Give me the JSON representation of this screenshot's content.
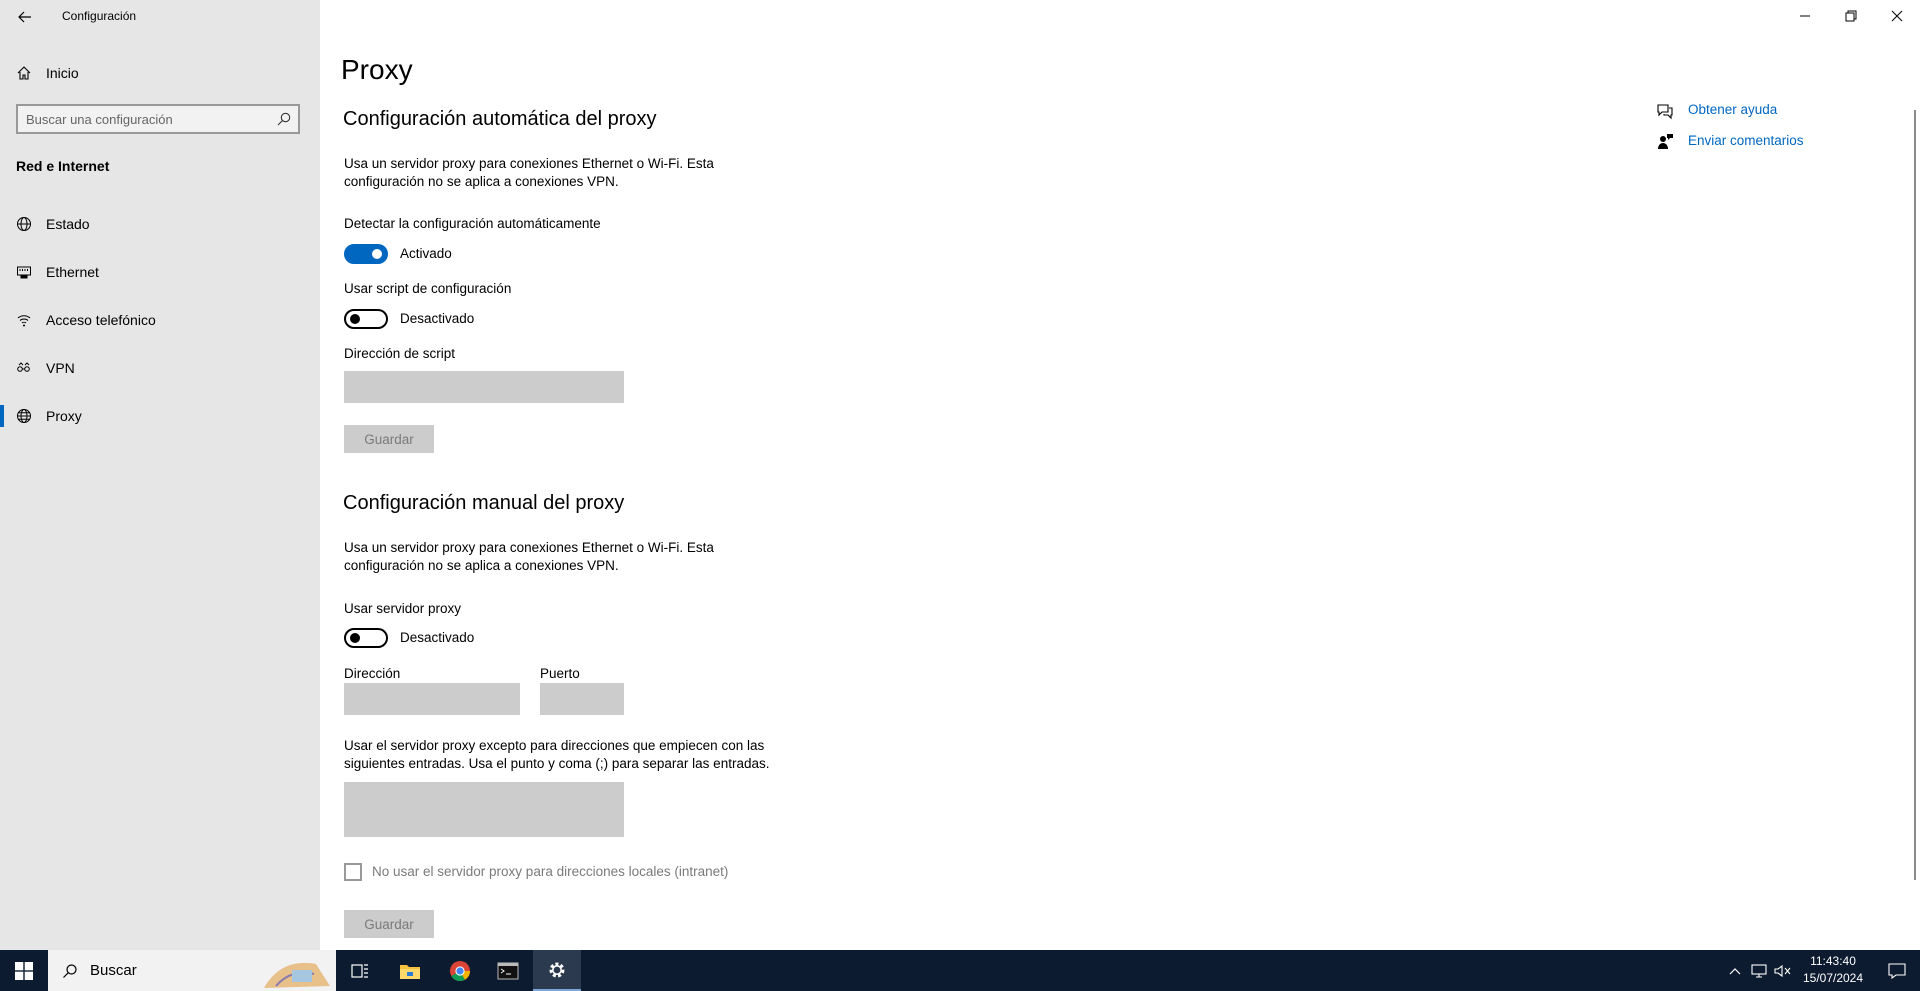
{
  "window": {
    "title": "Configuración",
    "back_icon": "back-arrow-icon",
    "controls": [
      "minimize-icon",
      "restore-icon",
      "close-icon"
    ]
  },
  "sidebar": {
    "home_label": "Inicio",
    "search": {
      "placeholder": "Buscar una configuración",
      "value": ""
    },
    "section_label": "Red e Internet",
    "items": [
      {
        "label": "Estado",
        "icon": "globe-status-icon",
        "active": false
      },
      {
        "label": "Ethernet",
        "icon": "ethernet-icon",
        "active": false
      },
      {
        "label": "Acceso telefónico",
        "icon": "dialup-icon",
        "active": false
      },
      {
        "label": "VPN",
        "icon": "vpn-icon",
        "active": false
      },
      {
        "label": "Proxy",
        "icon": "globe-icon",
        "active": true
      }
    ]
  },
  "main": {
    "page_title": "Proxy",
    "auto": {
      "heading": "Configuración automática del proxy",
      "description": "Usa un servidor proxy para conexiones Ethernet o Wi-Fi. Esta configuración no se aplica a conexiones VPN.",
      "detect_label": "Detectar la configuración automáticamente",
      "detect_state": "Activado",
      "detect_on": true,
      "script_label": "Usar script de configuración",
      "script_state": "Desactivado",
      "script_on": false,
      "address_label": "Dirección de script",
      "address_value": "",
      "save_label": "Guardar"
    },
    "manual": {
      "heading": "Configuración manual del proxy",
      "description": "Usa un servidor proxy para conexiones Ethernet o Wi-Fi. Esta configuración no se aplica a conexiones VPN.",
      "use_proxy_label": "Usar servidor proxy",
      "use_proxy_state": "Desactivado",
      "use_proxy_on": false,
      "address_label": "Dirección",
      "address_value": "",
      "port_label": "Puerto",
      "port_value": "",
      "exceptions_text": "Usar el servidor proxy excepto para direcciones que empiecen con las siguientes entradas. Usa el punto y coma (;) para separar las entradas.",
      "exceptions_value": "",
      "local_checkbox_label": "No usar el servidor proxy para direcciones locales (intranet)",
      "local_checked": false,
      "save_label": "Guardar"
    }
  },
  "help": {
    "get_help": "Obtener ayuda",
    "feedback": "Enviar comentarios"
  },
  "taskbar": {
    "search_label": "Buscar",
    "pinned": [
      "task-view-icon",
      "file-explorer-icon",
      "chrome-icon",
      "terminal-icon",
      "settings-icon"
    ],
    "time": "11:43:40",
    "date": "15/07/2024"
  },
  "colors": {
    "accent": "#0067c0",
    "sidebar_bg": "#e6e6e6",
    "taskbar_bg": "#0c1b2f",
    "disabled_field": "#cccccc"
  }
}
